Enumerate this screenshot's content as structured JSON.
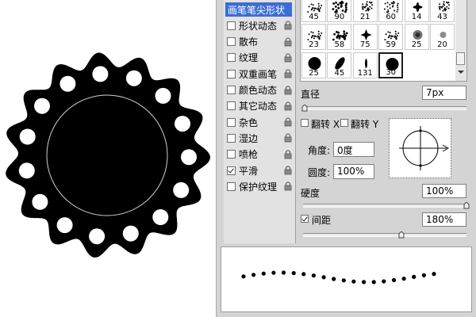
{
  "options_panel": {
    "items": [
      {
        "label": "画笔笔尖形状",
        "checked": null,
        "active": true,
        "locked": false
      },
      {
        "label": "形状动态",
        "checked": false,
        "active": false,
        "locked": true
      },
      {
        "label": "散布",
        "checked": false,
        "active": false,
        "locked": true
      },
      {
        "label": "纹理",
        "checked": false,
        "active": false,
        "locked": true
      },
      {
        "label": "双重画笔",
        "checked": false,
        "active": false,
        "locked": true
      },
      {
        "label": "颜色动态",
        "checked": false,
        "active": false,
        "locked": true
      },
      {
        "label": "其它动态",
        "checked": false,
        "active": false,
        "locked": true
      },
      {
        "label": "杂色",
        "checked": false,
        "active": false,
        "locked": true
      },
      {
        "label": "湿边",
        "checked": false,
        "active": false,
        "locked": true
      },
      {
        "label": "喷枪",
        "checked": false,
        "active": false,
        "locked": true
      },
      {
        "label": "平滑",
        "checked": true,
        "active": false,
        "locked": true
      },
      {
        "label": "保护纹理",
        "checked": false,
        "active": false,
        "locked": true
      }
    ]
  },
  "brush_tips": {
    "rows": [
      [
        "45",
        "90",
        "21",
        "60",
        "14",
        "43"
      ],
      [
        "23",
        "58",
        "75",
        "59",
        "25",
        "20"
      ],
      [
        "25",
        "45",
        "131",
        "30"
      ]
    ],
    "selected_size": "30"
  },
  "diameter": {
    "label": "直径",
    "value": "7px",
    "level": 0.01
  },
  "flip": {
    "x_label": "翻转 X",
    "y_label": "翻转 Y",
    "x_checked": false,
    "y_checked": false
  },
  "angle": {
    "label": "角度:",
    "value": "0度"
  },
  "roundness": {
    "label": "圆度:",
    "value": "100%"
  },
  "hardness": {
    "label": "硬度",
    "value": "100%",
    "level": 1.0
  },
  "spacing": {
    "label": "间距",
    "value": "180%",
    "checked": true,
    "level": 0.6
  },
  "colors": {
    "panel": "#d4d4d4",
    "highlight": "#3b6ed1",
    "art": "#000000"
  }
}
